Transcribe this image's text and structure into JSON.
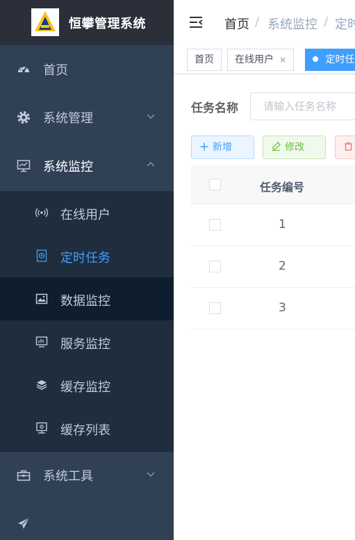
{
  "app": {
    "title": "恒攀管理系统"
  },
  "sidebar": {
    "items": [
      {
        "label": "首页",
        "icon": "dashboard-icon"
      },
      {
        "label": "系统管理",
        "icon": "gear-icon"
      },
      {
        "label": "系统监控",
        "icon": "monitor-icon"
      },
      {
        "label": "系统工具",
        "icon": "toolbox-icon"
      },
      {
        "label": "",
        "icon": "paper-plane-icon"
      }
    ],
    "submenu": [
      {
        "label": "在线用户",
        "icon": "online-icon"
      },
      {
        "label": "定时任务",
        "icon": "job-icon",
        "active": true
      },
      {
        "label": "数据监控",
        "icon": "druid-icon"
      },
      {
        "label": "服务监控",
        "icon": "server-icon"
      },
      {
        "label": "缓存监控",
        "icon": "redis-icon"
      },
      {
        "label": "缓存列表",
        "icon": "redis-list-icon"
      }
    ]
  },
  "breadcrumb": {
    "home": "首页",
    "sep": "/",
    "parent": "系统监控",
    "current": "定时"
  },
  "tags": [
    {
      "label": "首页"
    },
    {
      "label": "在线用户",
      "close": "×"
    },
    {
      "label": "定时任",
      "active": true
    }
  ],
  "search": {
    "label": "任务名称",
    "placeholder": "请输入任务名称"
  },
  "toolbar": {
    "add_label": "新增",
    "edit_label": "修改"
  },
  "table": {
    "columns": [
      "任务编号"
    ],
    "rows": [
      {
        "id": "1"
      },
      {
        "id": "2"
      },
      {
        "id": "3"
      }
    ]
  },
  "colors": {
    "sidebar_bg": "#304156",
    "submenu_bg": "#1f2d3d",
    "accent": "#409eff",
    "success": "#67c23a",
    "danger": "#f56c6c"
  }
}
